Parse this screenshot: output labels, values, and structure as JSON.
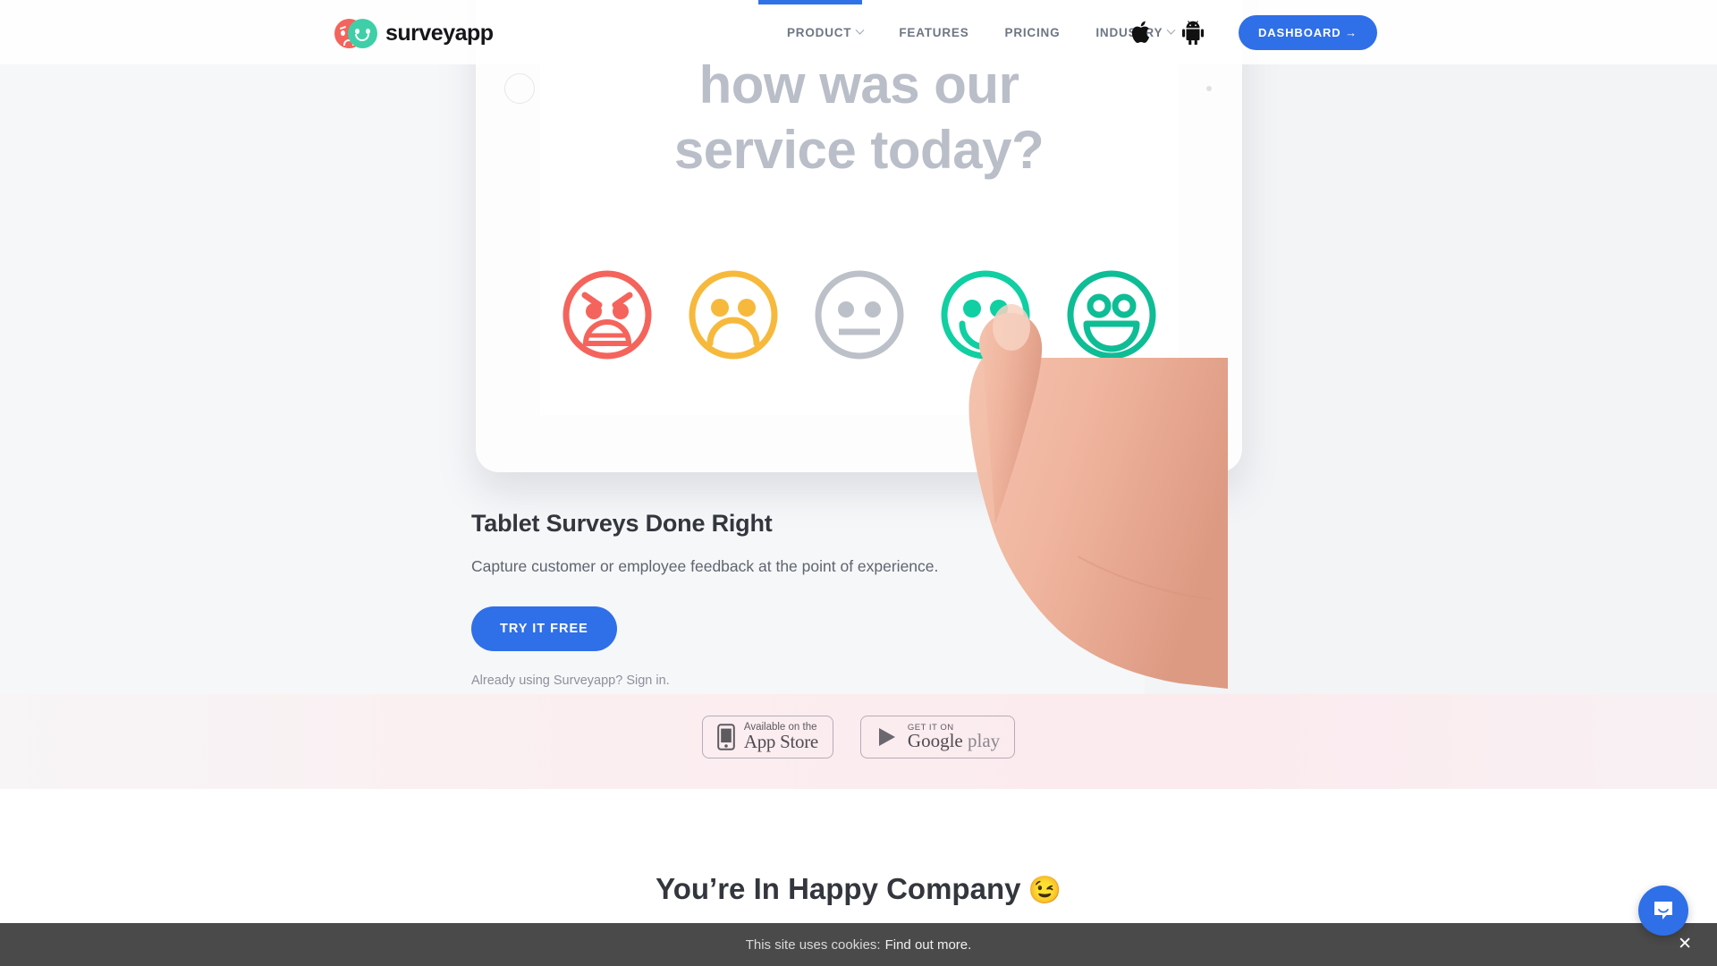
{
  "brand": {
    "name": "surveyapp",
    "accent_blue": "#2f6fe8",
    "logo_red": "#f4645c",
    "logo_teal": "#3fcfa8"
  },
  "header": {
    "nav": [
      {
        "label": "PRODUCT",
        "has_chevron": true,
        "icon": "chevron-down-icon"
      },
      {
        "label": "FEATURES",
        "has_chevron": false
      },
      {
        "label": "PRICING",
        "has_chevron": false
      },
      {
        "label": "INDUSTRY",
        "has_chevron": true,
        "icon": "chevron-down-icon"
      }
    ],
    "apple_icon": "apple-icon",
    "android_icon": "android-icon",
    "dashboard_label": "DASHBOARD →"
  },
  "tablet": {
    "question": "how was our\nservice today?",
    "question_line1": "how was our",
    "question_line2": "service today?",
    "faces": [
      {
        "name": "angry",
        "color": "#f4645c",
        "label": "Angry"
      },
      {
        "name": "sad",
        "color": "#f7b93c",
        "label": "Sad"
      },
      {
        "name": "neutral",
        "color": "#bcc0c9",
        "label": "Neutral"
      },
      {
        "name": "happy",
        "color": "#10cfa2",
        "label": "Happy"
      },
      {
        "name": "very-happy",
        "color": "#0ebd95",
        "label": "Very Happy"
      }
    ],
    "selected_face": "happy"
  },
  "hero": {
    "title": "Tablet Surveys Done Right",
    "subtitle": "Capture customer or employee feedback at the point of experience.",
    "cta_label": "TRY IT FREE",
    "signin_prefix": "Already using Surveyapp? ",
    "signin_link": "Sign in."
  },
  "store_badges": [
    {
      "name": "app-store",
      "small": "Available on the",
      "big": "App Store",
      "icon": "iphone-icon"
    },
    {
      "name": "google-play",
      "small": "GET IT ON",
      "big_brand": "Google",
      "big_suffix": "play",
      "icon": "play-triangle-icon"
    }
  ],
  "happy_section": {
    "title": "You’re In Happy Company",
    "emoji": "😉"
  },
  "cookie_bar": {
    "text": "This site uses cookies:",
    "link": "Find out more.",
    "close_icon": "close-icon"
  },
  "chat_widget": {
    "name": "intercom-chat-button",
    "icon": "chat-bubble-icon",
    "color": "#2f6fe8"
  }
}
